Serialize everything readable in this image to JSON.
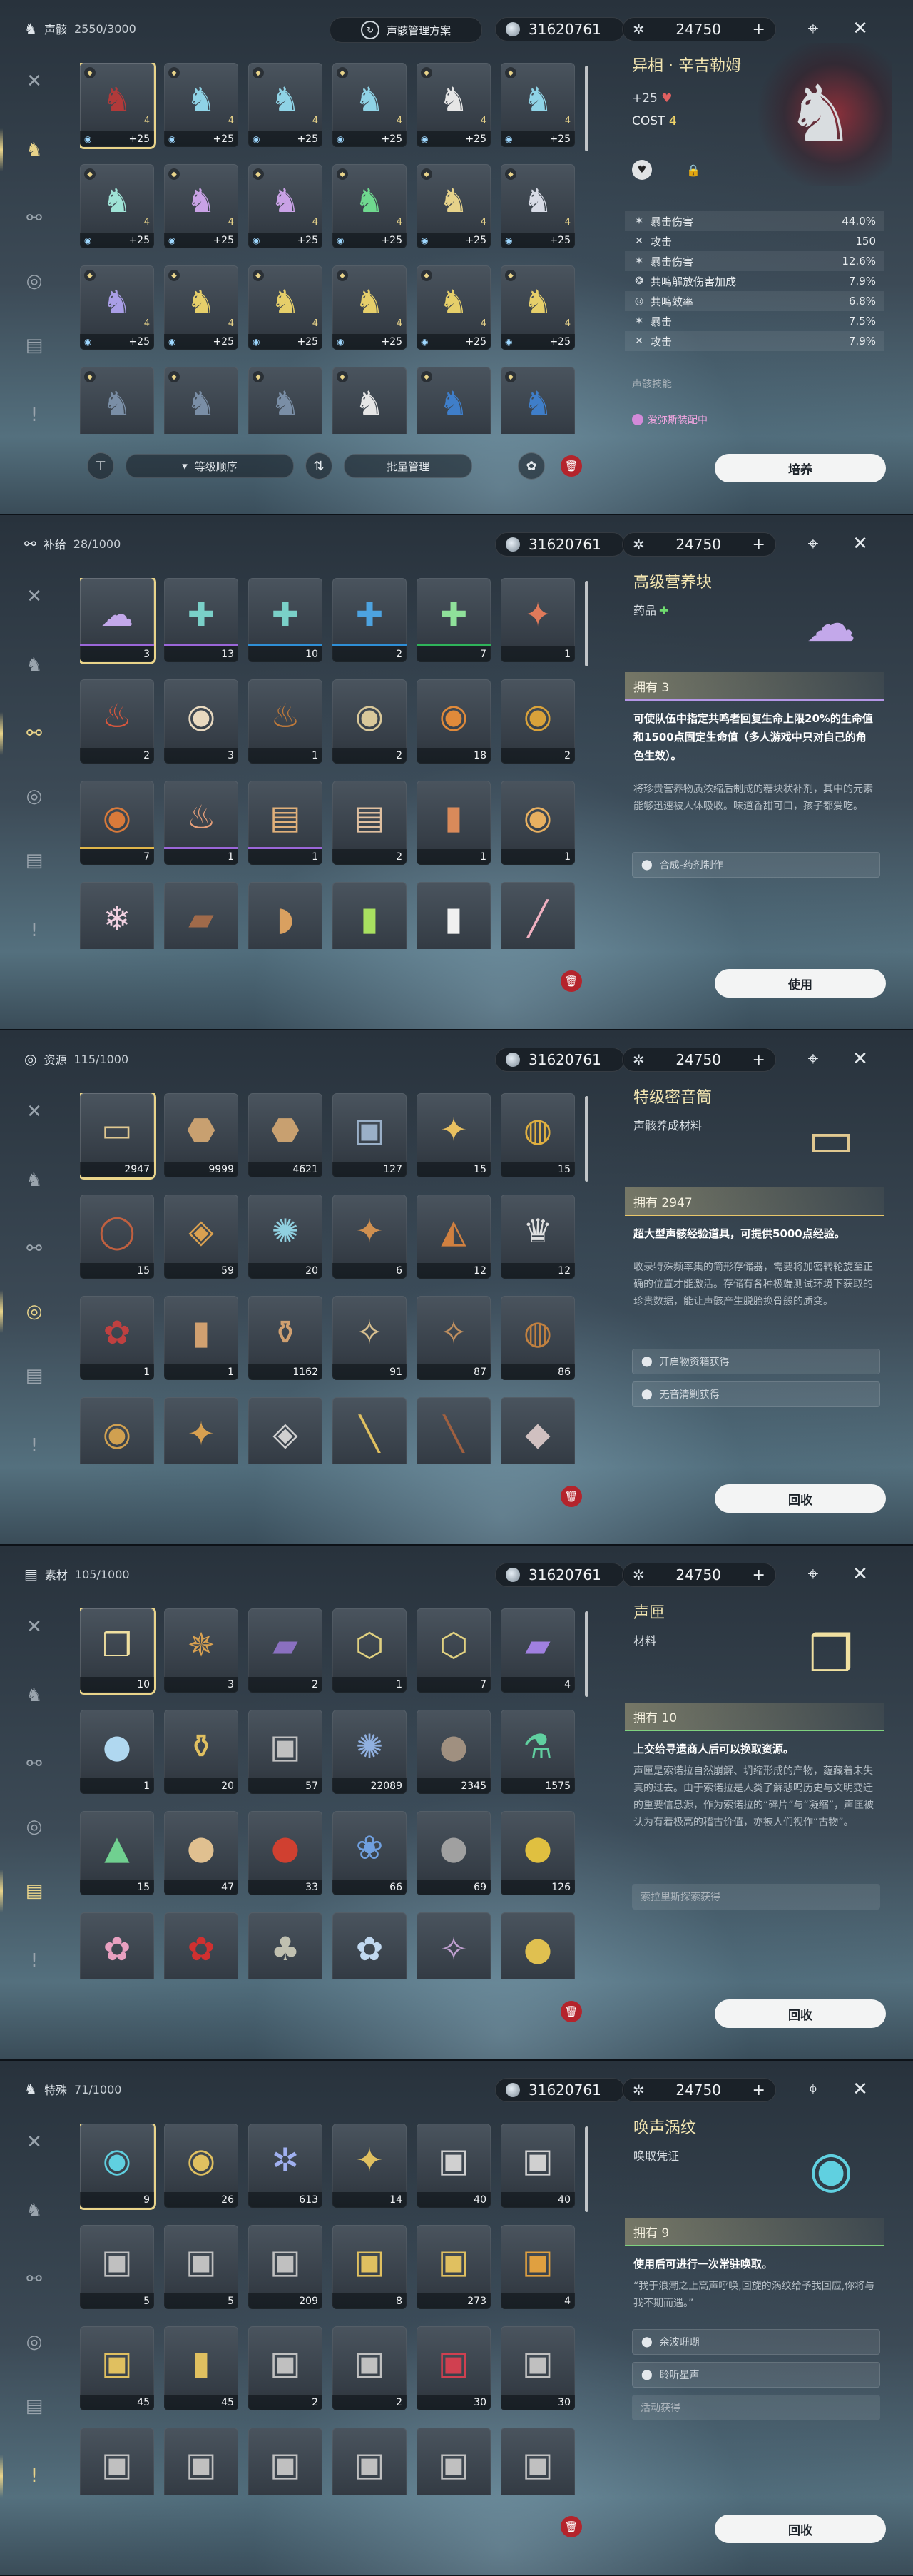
{
  "rail": [
    "sword-icon",
    "echo-icon",
    "supply-icon",
    "resource-icon",
    "material-icon",
    "special-icon"
  ],
  "currency": {
    "shell": "31620761",
    "astrite": "24750",
    "plus": "+"
  },
  "p1": {
    "tab_name": "声骸",
    "count": "2550/3000",
    "preset": "声骸管理方案",
    "cells": [
      {
        "q": "+25",
        "l": "4",
        "c": "#b13a3a"
      },
      {
        "q": "+25",
        "l": "4",
        "c": "#8fd3e6"
      },
      {
        "q": "+25",
        "l": "4",
        "c": "#8fd3e6"
      },
      {
        "q": "+25",
        "l": "4",
        "c": "#8fd3e6"
      },
      {
        "q": "+25",
        "l": "4",
        "c": "#e6e6e6"
      },
      {
        "q": "+25",
        "l": "4",
        "c": "#8fd3e6"
      },
      {
        "q": "+25",
        "l": "4",
        "c": "#9fe3d6"
      },
      {
        "q": "+25",
        "l": "4",
        "c": "#c9a2e6"
      },
      {
        "q": "+25",
        "l": "4",
        "c": "#c9a2e6"
      },
      {
        "q": "+25",
        "l": "4",
        "c": "#6fd98f"
      },
      {
        "q": "+25",
        "l": "4",
        "c": "#e6d28a"
      },
      {
        "q": "+25",
        "l": "4",
        "c": "#d7dbe6"
      },
      {
        "q": "+25",
        "l": "4",
        "c": "#a99ee6"
      },
      {
        "q": "+25",
        "l": "4",
        "c": "#e6cf6a"
      },
      {
        "q": "+25",
        "l": "4",
        "c": "#e6cf6a"
      },
      {
        "q": "+25",
        "l": "4",
        "c": "#e6cf6a"
      },
      {
        "q": "+25",
        "l": "4",
        "c": "#e6cf6a"
      },
      {
        "q": "+25",
        "l": "4",
        "c": "#e6cf6a"
      },
      {
        "q": "",
        "l": "",
        "c": "#7a8ea6"
      },
      {
        "q": "",
        "l": "",
        "c": "#7a8ea6"
      },
      {
        "q": "",
        "l": "",
        "c": "#7a8ea6"
      },
      {
        "q": "",
        "l": "",
        "c": "#e6e6e6"
      },
      {
        "q": "",
        "l": "",
        "c": "#3f7ec9"
      },
      {
        "q": "",
        "l": "",
        "c": "#3f7ec9"
      }
    ],
    "sort_label": "等级顺序",
    "batch_label": "批量管理",
    "title": "异相 · 辛吉勒姆",
    "plus_level": "+25",
    "cost_label": "COST",
    "cost_value": "4",
    "stats": [
      {
        "icon": "✶",
        "name": "暴击伤害",
        "value": "44.0%"
      },
      {
        "icon": "✕",
        "name": "攻击",
        "value": "150"
      },
      {
        "icon": "✶",
        "name": "暴击伤害",
        "value": "12.6%"
      },
      {
        "icon": "❂",
        "name": "共鸣解放伤害加成",
        "value": "7.9%"
      },
      {
        "icon": "◎",
        "name": "共鸣效率",
        "value": "6.8%"
      },
      {
        "icon": "✶",
        "name": "暴击",
        "value": "7.5%"
      },
      {
        "icon": "✕",
        "name": "攻击",
        "value": "7.9%"
      }
    ],
    "skill_label": "声骸技能",
    "equipped": "爱弥斯装配中",
    "action": "培养"
  },
  "p2": {
    "tab_name": "补给",
    "count": "28/1000",
    "cells": [
      {
        "q": "3",
        "g": "☁",
        "c": "#c3a8ea",
        "b": "#9b67d9",
        "s": true
      },
      {
        "q": "13",
        "g": "✚",
        "c": "#7ad0c8",
        "b": "#9b67d9"
      },
      {
        "q": "10",
        "g": "✚",
        "c": "#7ad0c8",
        "b": "#2f8fd6"
      },
      {
        "q": "2",
        "g": "✚",
        "c": "#4da3e0",
        "b": "#2f8fd6"
      },
      {
        "q": "7",
        "g": "✚",
        "c": "#8fe09a",
        "b": "#2fb45a"
      },
      {
        "q": "1",
        "g": "✦",
        "c": "#e07a5a",
        "b": ""
      },
      {
        "q": "2",
        "g": "♨",
        "c": "#d9573d",
        "b": ""
      },
      {
        "q": "3",
        "g": "◉",
        "c": "#e8d9c0",
        "b": ""
      },
      {
        "q": "1",
        "g": "♨",
        "c": "#c07a3a",
        "b": ""
      },
      {
        "q": "2",
        "g": "◉",
        "c": "#d9c89a",
        "b": ""
      },
      {
        "q": "18",
        "g": "◉",
        "c": "#e08a3a",
        "b": ""
      },
      {
        "q": "2",
        "g": "◉",
        "c": "#d9a23a",
        "b": ""
      },
      {
        "q": "7",
        "g": "◉",
        "c": "#d97a3a",
        "b": "#e0b64a"
      },
      {
        "q": "1",
        "g": "♨",
        "c": "#e8a07a",
        "b": "#9b67d9"
      },
      {
        "q": "1",
        "g": "▤",
        "c": "#e0b07a",
        "b": "#9b67d9"
      },
      {
        "q": "2",
        "g": "▤",
        "c": "#e0c0a0",
        "b": ""
      },
      {
        "q": "1",
        "g": "▮",
        "c": "#d98a5a",
        "b": ""
      },
      {
        "q": "1",
        "g": "◉",
        "c": "#e8b060",
        "b": ""
      },
      {
        "q": "",
        "g": "❄",
        "c": "#f0d0e0",
        "b": ""
      },
      {
        "q": "",
        "g": "▰",
        "c": "#a06a4a",
        "b": ""
      },
      {
        "q": "",
        "g": "◗",
        "c": "#d9a060",
        "b": ""
      },
      {
        "q": "",
        "g": "▮",
        "c": "#a8e060",
        "b": ""
      },
      {
        "q": "",
        "g": "▮",
        "c": "#f0f0f0",
        "b": ""
      },
      {
        "q": "",
        "g": "╱",
        "c": "#f0b0c0",
        "b": ""
      }
    ],
    "title": "高级营养块",
    "subtitle": "药品",
    "owned": "拥有 3",
    "desc": "可使队伍中指定共鸣者回复生命上限20%的生命值和1500点固定生命值（多人游戏中只对自己的角色生效）。",
    "lore": "将珍贵营养物质浓缩后制成的糖块状补剂，其中的元素能够迅速被人体吸收。味道香甜可口，孩子都爱吃。",
    "source": "合成-药剂制作",
    "action": "使用"
  },
  "p3": {
    "tab_name": "资源",
    "count": "115/1000",
    "cells": [
      {
        "q": "2947",
        "g": "▭",
        "c": "#e0c890",
        "s": true
      },
      {
        "q": "9999",
        "g": "⬣",
        "c": "#c8a070"
      },
      {
        "q": "4621",
        "g": "⬣",
        "c": "#c8a070"
      },
      {
        "q": "127",
        "g": "▣",
        "c": "#9ab0c8"
      },
      {
        "q": "15",
        "g": "✦",
        "c": "#e8c060"
      },
      {
        "q": "15",
        "g": "◍",
        "c": "#e0b040"
      },
      {
        "q": "15",
        "g": "◯",
        "c": "#c06040"
      },
      {
        "q": "59",
        "g": "◈",
        "c": "#d9a050"
      },
      {
        "q": "20",
        "g": "✺",
        "c": "#90d0e0"
      },
      {
        "q": "6",
        "g": "✦",
        "c": "#d09050"
      },
      {
        "q": "12",
        "g": "◭",
        "c": "#d08040"
      },
      {
        "q": "12",
        "g": "♛",
        "c": "#e0e0e0"
      },
      {
        "q": "1",
        "g": "✿",
        "c": "#c04040"
      },
      {
        "q": "1",
        "g": "▮",
        "c": "#d0a070"
      },
      {
        "q": "1162",
        "g": "⚱",
        "c": "#d0a070"
      },
      {
        "q": "91",
        "g": "✧",
        "c": "#d8c090"
      },
      {
        "q": "87",
        "g": "✧",
        "c": "#c09060"
      },
      {
        "q": "86",
        "g": "◍",
        "c": "#c08040"
      },
      {
        "q": "",
        "g": "◉",
        "c": "#d0a050"
      },
      {
        "q": "",
        "g": "✦",
        "c": "#d8a050"
      },
      {
        "q": "",
        "g": "◈",
        "c": "#d0d0d0"
      },
      {
        "q": "",
        "g": "╲",
        "c": "#e0c060"
      },
      {
        "q": "",
        "g": "╲",
        "c": "#a06040"
      },
      {
        "q": "",
        "g": "◆",
        "c": "#d0c0c0"
      }
    ],
    "title": "特级密音筒",
    "subtitle": "声骸养成材料",
    "owned": "拥有 2947",
    "desc": "超大型声骸经验道具，可提供5000点经验。",
    "lore": "收录特殊频率集的筒形存储器，需要将加密转轮旋至正确的位置才能激活。存储有各种极端测试环境下获取的珍贵数据，能让声骸产生脱胎换骨般的质变。",
    "sources": [
      "开启物资箱获得",
      "无音清剿获得"
    ],
    "action": "回收"
  },
  "p4": {
    "tab_name": "素材",
    "count": "105/1000",
    "cells": [
      {
        "q": "10",
        "g": "❒",
        "c": "#f0e0a0",
        "s": true
      },
      {
        "q": "3",
        "g": "✵",
        "c": "#d8a050"
      },
      {
        "q": "2",
        "g": "▰",
        "c": "#8a70c0"
      },
      {
        "q": "1",
        "g": "⬡",
        "c": "#e0d080"
      },
      {
        "q": "7",
        "g": "⬡",
        "c": "#e0d080"
      },
      {
        "q": "4",
        "g": "▰",
        "c": "#a080e0"
      },
      {
        "q": "1",
        "g": "●",
        "c": "#b0d8f0"
      },
      {
        "q": "20",
        "g": "⚱",
        "c": "#e0c060"
      },
      {
        "q": "57",
        "g": "▣",
        "c": "#c0c0c0"
      },
      {
        "q": "22089",
        "g": "✺",
        "c": "#90b0e0"
      },
      {
        "q": "2345",
        "g": "●",
        "c": "#a09080"
      },
      {
        "q": "1575",
        "g": "⚗",
        "c": "#60d0a0"
      },
      {
        "q": "15",
        "g": "▲",
        "c": "#70d090"
      },
      {
        "q": "47",
        "g": "●",
        "c": "#e0c090"
      },
      {
        "q": "33",
        "g": "●",
        "c": "#d04030"
      },
      {
        "q": "66",
        "g": "❀",
        "c": "#70a0e0"
      },
      {
        "q": "69",
        "g": "●",
        "c": "#a0a0a0"
      },
      {
        "q": "126",
        "g": "●",
        "c": "#e0c040"
      },
      {
        "q": "",
        "g": "✿",
        "c": "#e8a0c0"
      },
      {
        "q": "",
        "g": "✿",
        "c": "#d03030"
      },
      {
        "q": "",
        "g": "♣",
        "c": "#c0c0b0"
      },
      {
        "q": "",
        "g": "✿",
        "c": "#c0d8f0"
      },
      {
        "q": "",
        "g": "✧",
        "c": "#c0a0d0"
      },
      {
        "q": "",
        "g": "●",
        "c": "#e0c050"
      }
    ],
    "title": "声匣",
    "subtitle": "材料",
    "owned": "拥有 10",
    "desc": "上交给寻遗商人后可以换取资源。",
    "lore": "声匣是索诺拉自然崩解、坍缩形成的产物，蕴藏着未失真的过去。由于索诺拉是人类了解悲鸣历史与文明变迁的重要信息源，作为索诺拉的“碎片”与“凝缩”，声匣被认为有着极高的稽古价值，亦被人们视作“古物”。",
    "source": "索拉里斯探索获得",
    "action": "回收"
  },
  "p5": {
    "tab_name": "特殊",
    "count": "71/1000",
    "cells": [
      {
        "q": "9",
        "g": "◉",
        "c": "#60d0e0",
        "s": true
      },
      {
        "q": "26",
        "g": "◉",
        "c": "#e0c060"
      },
      {
        "q": "613",
        "g": "✲",
        "c": "#a0b0f0"
      },
      {
        "q": "14",
        "g": "✦",
        "c": "#e0c060"
      },
      {
        "q": "40",
        "g": "▣",
        "c": "#d0d0d0"
      },
      {
        "q": "40",
        "g": "▣",
        "c": "#d0d0d0"
      },
      {
        "q": "5",
        "g": "▣",
        "c": "#c0c0c0"
      },
      {
        "q": "5",
        "g": "▣",
        "c": "#c0c0c0"
      },
      {
        "q": "209",
        "g": "▣",
        "c": "#c0c0c0"
      },
      {
        "q": "8",
        "g": "▣",
        "c": "#e0c060"
      },
      {
        "q": "273",
        "g": "▣",
        "c": "#e0c060"
      },
      {
        "q": "4",
        "g": "▣",
        "c": "#e0a040"
      },
      {
        "q": "45",
        "g": "▣",
        "c": "#e0c060"
      },
      {
        "q": "45",
        "g": "▮",
        "c": "#e0c060"
      },
      {
        "q": "2",
        "g": "▣",
        "c": "#c0c0c0"
      },
      {
        "q": "2",
        "g": "▣",
        "c": "#c0c0c0"
      },
      {
        "q": "30",
        "g": "▣",
        "c": "#d04050"
      },
      {
        "q": "30",
        "g": "▣",
        "c": "#c0c0c0"
      },
      {
        "q": "",
        "g": "▣",
        "c": "#c0c0c0"
      },
      {
        "q": "",
        "g": "▣",
        "c": "#c0c0c0"
      },
      {
        "q": "",
        "g": "▣",
        "c": "#c0c0c0"
      },
      {
        "q": "",
        "g": "▣",
        "c": "#c0c0c0"
      },
      {
        "q": "",
        "g": "▣",
        "c": "#c0c0c0"
      },
      {
        "q": "",
        "g": "▣",
        "c": "#c0c0c0"
      }
    ],
    "title": "唤声涡纹",
    "subtitle": "唤取凭证",
    "owned": "拥有 9",
    "desc": "使用后可进行一次常驻唤取。",
    "lore": "“我于浪潮之上高声呼唤,回旋的涡纹给予我回应,你将与我不期而遇。”",
    "sources": [
      "余波珊瑚",
      "聆听星声"
    ],
    "source_plain": "活动获得",
    "action": "回收"
  }
}
